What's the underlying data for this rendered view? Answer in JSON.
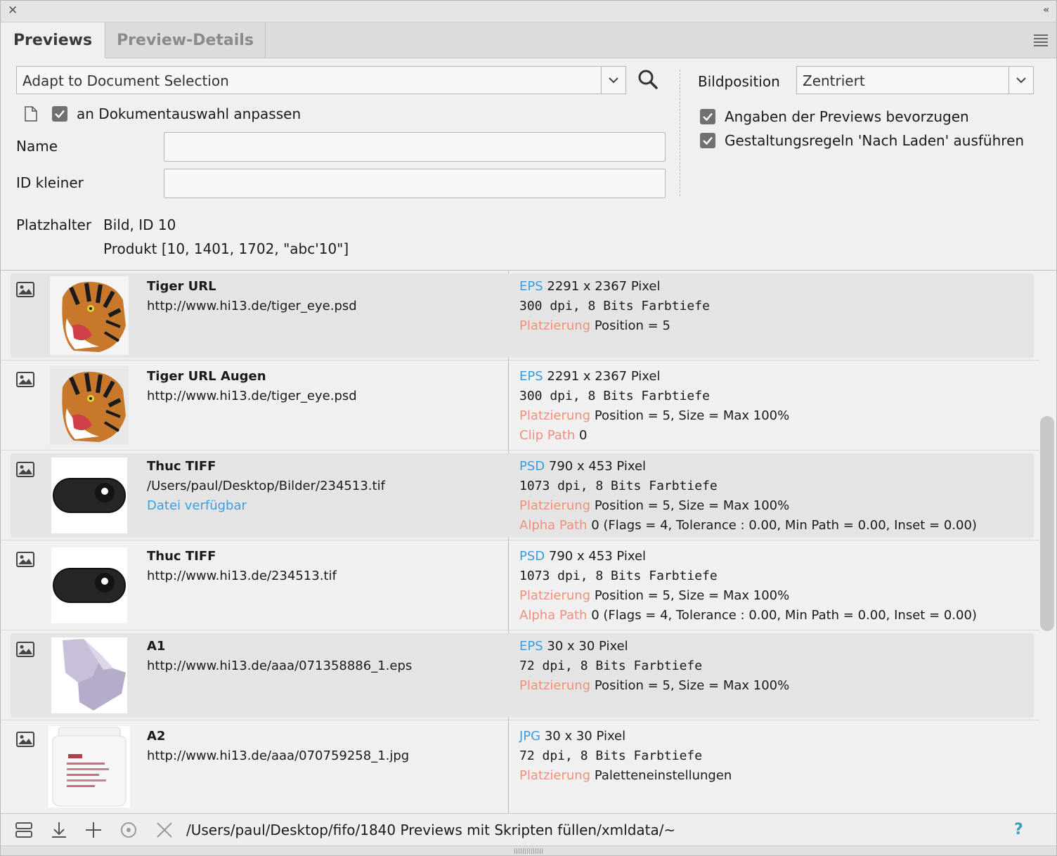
{
  "tabs": [
    {
      "label": "Previews",
      "active": true
    },
    {
      "label": "Preview-Details",
      "active": false
    }
  ],
  "search": {
    "combo_value": "Adapt to Document Selection",
    "adapt_label": "an Dokumentauswahl anpassen",
    "adapt_checked": true,
    "name_label": "Name",
    "name_value": "",
    "id_label": "ID kleiner",
    "id_value": ""
  },
  "placeholder": {
    "label": "Platzhalter",
    "line1": "Bild, ID 10",
    "line2": "Produkt [10, 1401, 1702, \"abc'10\"]"
  },
  "options": {
    "bildposition_label": "Bildposition",
    "bildposition_value": "Zentriert",
    "opt1_label": "Angaben der Previews bevorzugen",
    "opt1_checked": true,
    "opt2_label": "Gestaltungsregeln 'Nach Laden' ausführen",
    "opt2_checked": true
  },
  "previews": [
    {
      "title": "Tiger URL",
      "path": "http://www.hi13.de/tiger_eye.psd",
      "status": "",
      "format": "EPS",
      "size": "2291 x 2367 Pixel",
      "res": "300 dpi, 8 Bits Farbtiefe",
      "placement_label": "Platzierung",
      "placement": "Position = 5",
      "path_label": "",
      "path_value": "",
      "thumb": "tiger",
      "highlighted": true
    },
    {
      "title": "Tiger URL Augen",
      "path": "http://www.hi13.de/tiger_eye.psd",
      "status": "",
      "format": "EPS",
      "size": "2291 x 2367 Pixel",
      "res": "300 dpi, 8 Bits Farbtiefe",
      "placement_label": "Platzierung",
      "placement": "Position = 5, Size = Max 100%",
      "path_label": "Clip Path",
      "path_value": "0",
      "thumb": "tiger",
      "highlighted": false
    },
    {
      "title": "Thuc TIFF",
      "path": "/Users/paul/Desktop/Bilder/234513.tif",
      "status": "Datei verfügbar",
      "format": "PSD",
      "size": "790 x 453 Pixel",
      "res": "1073 dpi, 8 Bits Farbtiefe",
      "placement_label": "Platzierung",
      "placement": "Position = 5, Size = Max 100%",
      "path_label": "Alpha Path",
      "path_value": "0 (Flags = 4, Tolerance : 0.00, Min Path = 0.00, Inset = 0.00)",
      "thumb": "toggle",
      "highlighted": true
    },
    {
      "title": "Thuc TIFF",
      "path": "http://www.hi13.de/234513.tif",
      "status": "",
      "format": "PSD",
      "size": "790 x 453 Pixel",
      "res": "1073 dpi, 8 Bits Farbtiefe",
      "placement_label": "Platzierung",
      "placement": "Position = 5, Size = Max 100%",
      "path_label": "Alpha Path",
      "path_value": "0 (Flags = 4, Tolerance : 0.00, Min Path = 0.00, Inset = 0.00)",
      "thumb": "toggle",
      "highlighted": false
    },
    {
      "title": "A1",
      "path": "http://www.hi13.de/aaa/071358886_1.eps",
      "status": "",
      "format": "EPS",
      "size": "30 x 30 Pixel",
      "res": "72 dpi, 8 Bits Farbtiefe",
      "placement_label": "Platzierung",
      "placement": "Position = 5, Size = Max 100%",
      "path_label": "",
      "path_value": "",
      "thumb": "soap",
      "highlighted": true
    },
    {
      "title": "A2",
      "path": "http://www.hi13.de/aaa/070759258_1.jpg",
      "status": "",
      "format": "JPG",
      "size": "30 x 30 Pixel",
      "res": "72 dpi, 8 Bits Farbtiefe",
      "placement_label": "Platzierung",
      "placement": "Paletteneinstellungen",
      "path_label": "",
      "path_value": "",
      "thumb": "jar",
      "highlighted": false
    }
  ],
  "footer": {
    "path": "/Users/paul/Desktop/fifo/1840 Previews mit Skripten füllen/xmldata/~",
    "help": "?"
  },
  "icons": {
    "close": "close-icon",
    "collapse": "collapse-icon",
    "menu": "panel-menu-icon",
    "search": "search-icon",
    "document": "document-icon",
    "image": "image-icon",
    "list": "list-view-icon",
    "download": "download-icon",
    "add": "add-icon",
    "target": "target-icon",
    "delete": "delete-icon"
  },
  "colors": {
    "format_label": "#3a9de0",
    "property_label": "#f0907c",
    "help": "#3aa0b4"
  }
}
